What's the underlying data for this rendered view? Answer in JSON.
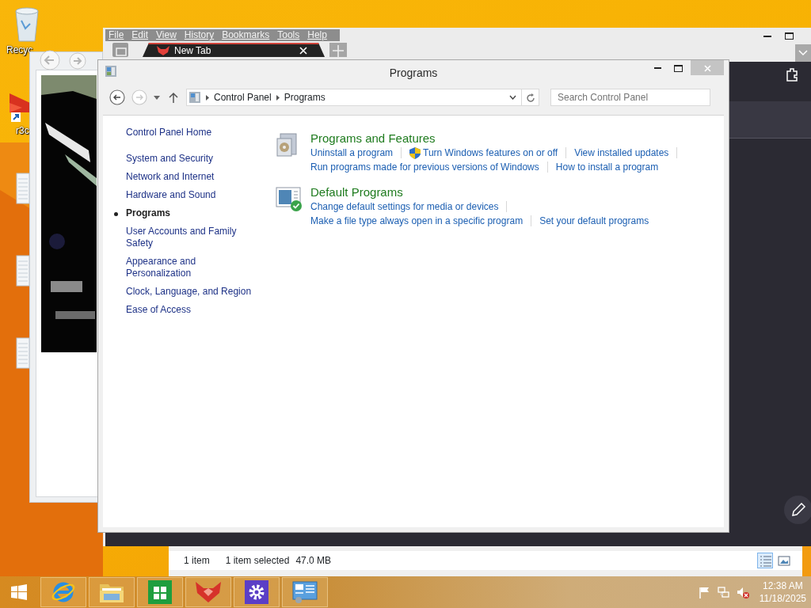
{
  "desktop": {
    "icons": [
      {
        "kind": "recycle_bin",
        "label": "Recyc"
      },
      {
        "kind": "shortcut",
        "label": "r3c"
      },
      {
        "kind": "document"
      },
      {
        "kind": "document"
      },
      {
        "kind": "document"
      }
    ]
  },
  "browser": {
    "menu": [
      "File",
      "Edit",
      "View",
      "History",
      "Bookmarks",
      "Tools",
      "Help"
    ],
    "tabs": [
      {
        "label": "New Tab",
        "selected": true
      }
    ]
  },
  "control_panel": {
    "title": "Programs",
    "breadcrumb": [
      "Control Panel",
      "Programs"
    ],
    "search": {
      "placeholder": "Search Control Panel"
    },
    "nav": [
      {
        "kind": "home",
        "label": "Control Panel Home",
        "selected": false
      },
      {
        "kind": "category",
        "label": "System and Security",
        "selected": false
      },
      {
        "kind": "category",
        "label": "Network and Internet",
        "selected": false
      },
      {
        "kind": "category",
        "label": "Hardware and Sound",
        "selected": false
      },
      {
        "kind": "category",
        "label": "Programs",
        "selected": true
      },
      {
        "kind": "category",
        "label": "User Accounts and Family Safety",
        "selected": false
      },
      {
        "kind": "category",
        "label": "Appearance and Personalization",
        "selected": false
      },
      {
        "kind": "category",
        "label": "Clock, Language, and Region",
        "selected": false
      },
      {
        "kind": "category",
        "label": "Ease of Access",
        "selected": false
      }
    ],
    "sections": [
      {
        "kind": "programs",
        "title": "Programs and Features",
        "lines": [
          [
            {
              "text": "Uninstall a program",
              "shield": false
            },
            {
              "text": "Turn Windows features on or off",
              "shield": true
            },
            {
              "text": "View installed updates",
              "shield": false
            }
          ],
          [
            {
              "text": "Run programs made for previous versions of Windows",
              "shield": false
            },
            {
              "text": "How to install a program",
              "shield": false
            }
          ]
        ]
      },
      {
        "kind": "defaults",
        "title": "Default Programs",
        "lines": [
          [
            {
              "text": "Change default settings for media or devices",
              "shield": false
            }
          ],
          [
            {
              "text": "Make a file type always open in a specific program",
              "shield": false
            },
            {
              "text": "Set your default programs",
              "shield": false
            }
          ]
        ]
      }
    ]
  },
  "status_bar": {
    "items": [
      "1 item",
      "1 item selected",
      "47.0 MB"
    ],
    "views": [
      {
        "kind": "details",
        "selected": true
      },
      {
        "kind": "large_icons",
        "selected": false
      }
    ]
  },
  "taskbar": {
    "apps": [
      {
        "kind": "start"
      },
      {
        "kind": "ie"
      },
      {
        "kind": "folder"
      },
      {
        "kind": "store"
      },
      {
        "kind": "fox"
      },
      {
        "kind": "settings"
      },
      {
        "kind": "control_panel"
      }
    ],
    "tray": [
      {
        "kind": "flag"
      },
      {
        "kind": "network"
      },
      {
        "kind": "volume",
        "muted": true
      }
    ],
    "clock": {
      "time": "12:38 AM",
      "date": "11/18/2025"
    }
  }
}
